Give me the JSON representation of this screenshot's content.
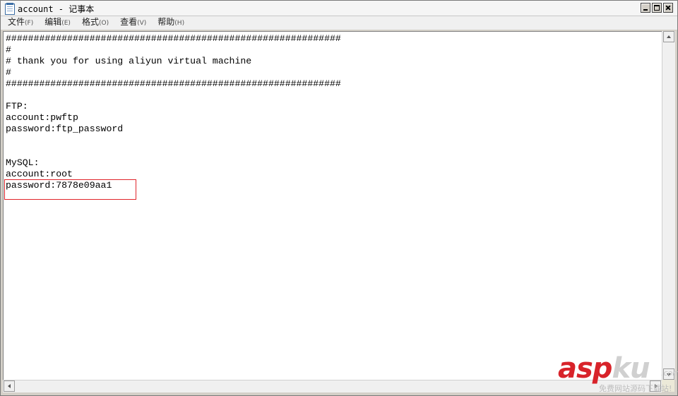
{
  "window": {
    "title": "account - 记事本"
  },
  "menu": [
    {
      "label": "文件",
      "accel": "(F)"
    },
    {
      "label": "编辑",
      "accel": "(E)"
    },
    {
      "label": "格式",
      "accel": "(O)"
    },
    {
      "label": "查看",
      "accel": "(V)"
    },
    {
      "label": "帮助",
      "accel": "(H)"
    }
  ],
  "document": {
    "text": "############################################################\n#\n# thank you for using aliyun virtual machine\n#\n############################################################\n\nFTP:\naccount:pwftp\npassword:ftp_password\n\n\nMySQL:\naccount:root\npassword:7878e09aa1"
  },
  "highlight": {
    "color": "#e0252b"
  },
  "watermark": {
    "brand_red": "asp",
    "brand_gray": "ku",
    "suffix": ".com",
    "tagline": "免费网站源码下载站!"
  },
  "colors": {
    "editor_bg": "#ffffff",
    "chrome_bg": "#d4d0c8",
    "watermark_red": "#d8232a"
  },
  "icons": [
    "notepad-app-icon",
    "minimize-icon",
    "maximize-icon",
    "close-icon",
    "scroll-up-icon",
    "scroll-down-icon",
    "scroll-left-icon",
    "scroll-right-icon"
  ]
}
